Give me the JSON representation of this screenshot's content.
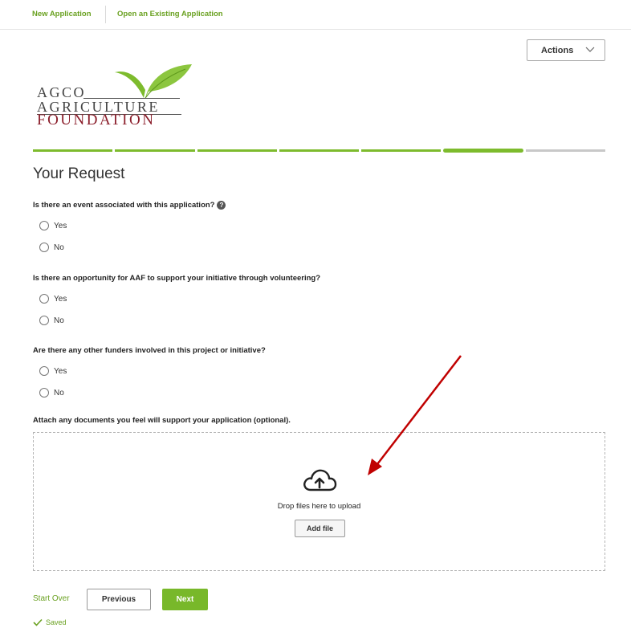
{
  "nav": {
    "new_application": "New Application",
    "open_existing": "Open an Existing Application"
  },
  "header": {
    "actions_label": "Actions"
  },
  "logo": {
    "line1": "AGCO",
    "line2": "AGRICULTURE",
    "line3": "FOUNDATION",
    "leaf_color": "#7dbb2d",
    "text_color": "#444444",
    "accent_color": "#8b1e2b"
  },
  "progress": {
    "total_steps": 7,
    "current_step": 6
  },
  "page": {
    "title": "Your Request"
  },
  "questions": [
    {
      "text": "Is there an event associated with this application?",
      "has_help": true,
      "options": [
        "Yes",
        "No"
      ]
    },
    {
      "text": "Is there an opportunity for AAF to support your initiative through volunteering?",
      "has_help": false,
      "options": [
        "Yes",
        "No"
      ]
    },
    {
      "text": "Are there any other funders involved in this project or initiative?",
      "has_help": false,
      "options": [
        "Yes",
        "No"
      ]
    }
  ],
  "attachments": {
    "label": "Attach any documents you feel will support your application (optional).",
    "drop_text": "Drop files here to upload",
    "add_file_label": "Add file",
    "icon": "cloud-upload-icon"
  },
  "footer": {
    "start_over": "Start Over",
    "previous": "Previous",
    "next": "Next",
    "saved": "Saved"
  },
  "colors": {
    "accent_green": "#78b82a",
    "link_green": "#6aa121",
    "annotation_arrow": "#c00000"
  }
}
